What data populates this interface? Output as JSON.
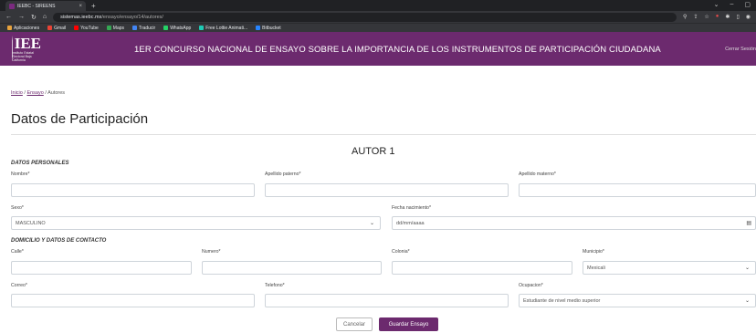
{
  "browser": {
    "tab_title": "IEEBC - SIREENS",
    "tab_close": "×",
    "new_tab": "+",
    "url_host": "sistemas.ieebc.mx",
    "url_path": "/ensayo/ensayo/14/autores/",
    "bookmarks": [
      {
        "label": "Aplicaciones",
        "color": "#e8a33d"
      },
      {
        "label": "Gmail",
        "color": "#ea4335"
      },
      {
        "label": "YouTube",
        "color": "#ff0000"
      },
      {
        "label": "Maps",
        "color": "#34a853"
      },
      {
        "label": "Traducir",
        "color": "#4285f4"
      },
      {
        "label": "WhatsApp",
        "color": "#25d366"
      },
      {
        "label": "Free Lottie Animati...",
        "color": "#1ecab4"
      },
      {
        "label": "Bitbucket",
        "color": "#2684ff"
      }
    ]
  },
  "header": {
    "logo_text": "IEE",
    "logo_sub": "Instituto Estatal Electoral Baja California",
    "title": "1ER CONCURSO NACIONAL DE ENSAYO SOBRE LA IMPORTANCIA DE LOS INSTRUMENTOS DE PARTICIPACIÓN CIUDADANA",
    "logout": "Cerrar Sesión"
  },
  "breadcrumb": {
    "home": "Inicio",
    "sep": "/",
    "ensayo": "Ensayo",
    "current": "Autores"
  },
  "page_title": "Datos de Participación",
  "author_heading": "AUTOR 1",
  "sections": {
    "personal": "DATOS PERSONALES",
    "contact": "DOMICILIO Y DATOS DE CONTACTO"
  },
  "fields": {
    "nombre": {
      "label": "Nombre*",
      "value": ""
    },
    "apellido_paterno": {
      "label": "Apellido paterno*",
      "value": ""
    },
    "apellido_materno": {
      "label": "Apellido materno*",
      "value": ""
    },
    "sexo": {
      "label": "Sexo*",
      "value": "MASCULINO"
    },
    "fecha_nacimiento": {
      "label": "Fecha nacimiento*",
      "placeholder": "dd/mm/aaaa"
    },
    "calle": {
      "label": "Calle*",
      "value": ""
    },
    "numero": {
      "label": "Numero*",
      "value": ""
    },
    "colonia": {
      "label": "Colonia*",
      "value": ""
    },
    "municipio": {
      "label": "Municipio*",
      "value": "Mexicali"
    },
    "correo": {
      "label": "Correo*",
      "value": ""
    },
    "telefono": {
      "label": "Telefono*",
      "value": ""
    },
    "ocupacion": {
      "label": "Ocupacion*",
      "value": "Estudiante de nivel medio superior"
    }
  },
  "buttons": {
    "cancel": "Cancelar",
    "save": "Guardar Ensayo"
  },
  "colors": {
    "brand": "#6c2a6e"
  }
}
